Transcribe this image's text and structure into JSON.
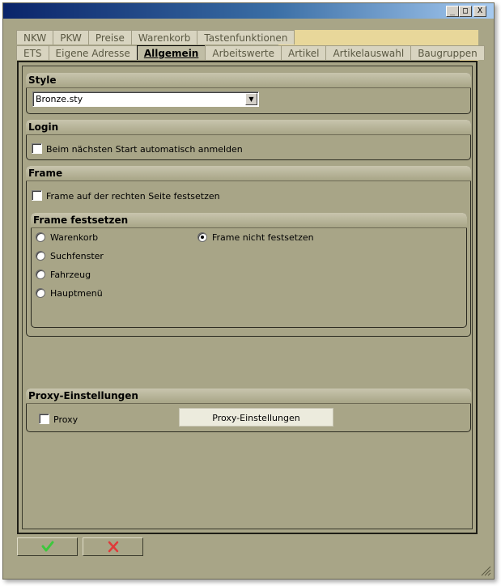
{
  "window": {
    "controls": {
      "minimize": "_",
      "maximize": "□",
      "close": "X"
    }
  },
  "tabs": {
    "row1": [
      "NKW",
      "PKW",
      "Preise",
      "Warenkorb",
      "Tastenfunktionen"
    ],
    "row2": [
      "ETS",
      "Eigene Adresse",
      "Allgemein",
      "Arbeitswerte",
      "Artikel",
      "Artikelauswahl",
      "Baugruppen"
    ],
    "active": "Allgemein",
    "overflow_icon": "chevron-down-icon"
  },
  "style": {
    "title": "Style",
    "value": "Bronze.sty"
  },
  "login": {
    "title": "Login",
    "auto_login_label": "Beim nächsten Start automatisch anmelden",
    "auto_login_checked": false
  },
  "frame": {
    "title": "Frame",
    "fix_right_label": "Frame auf der rechten Seite festsetzen",
    "fix_right_checked": false,
    "sub_title": "Frame festsetzen",
    "options": [
      "Warenkorb",
      "Suchfenster",
      "Fahrzeug",
      "Hauptmenü",
      "Frame nicht festsetzen"
    ],
    "selected": "Frame nicht festsetzen"
  },
  "proxy": {
    "title": "Proxy-Einstellungen",
    "checkbox_label": "Proxy",
    "checked": false,
    "button_label": "Proxy-Einstellungen"
  },
  "footer": {
    "ok_icon": "checkmark-icon",
    "cancel_icon": "cancel-x-icon"
  },
  "colors": {
    "background": "#a8a587",
    "tab_fill": "#e8d79a",
    "ok_green": "#3cc83c",
    "cancel_red": "#e03a3a"
  }
}
